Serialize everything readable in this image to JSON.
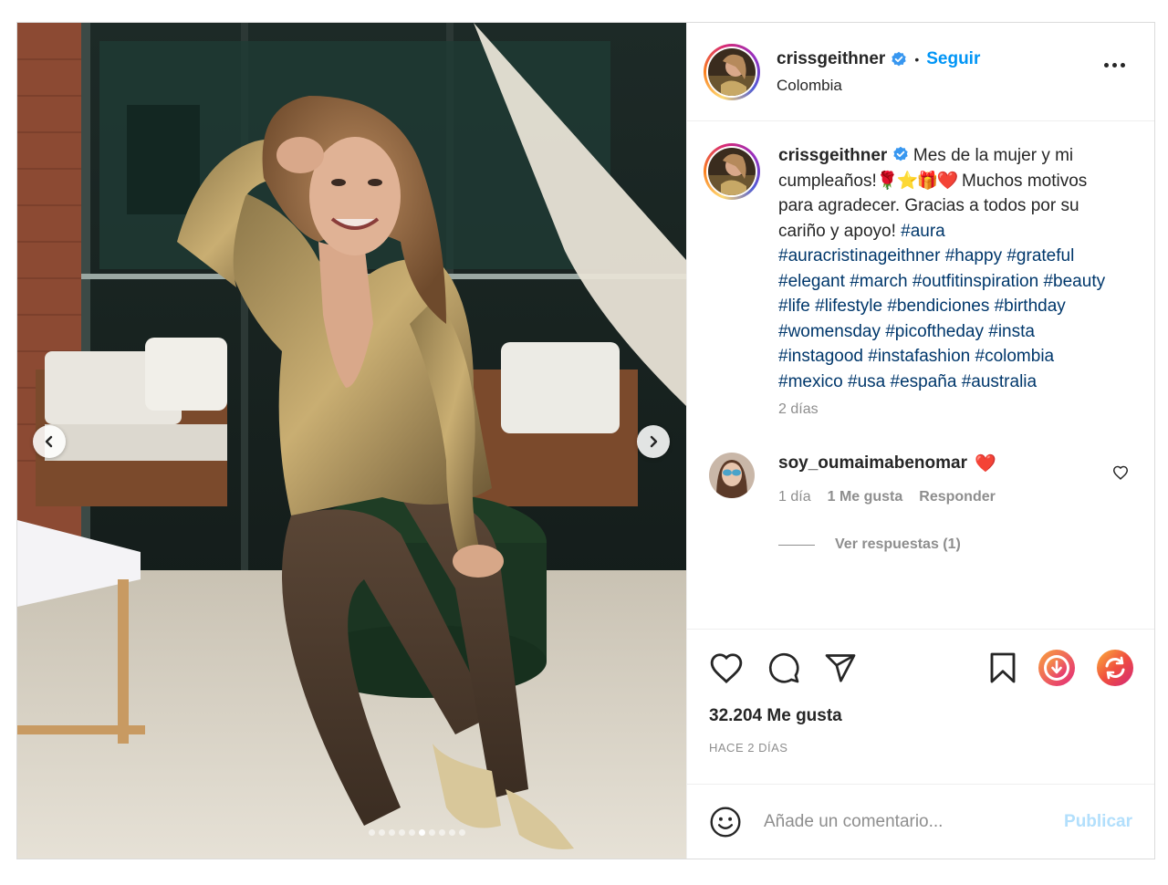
{
  "post": {
    "username": "crissgeithner",
    "verified": true,
    "follow_label": "Seguir",
    "separator": "•",
    "location": "Colombia"
  },
  "carousel": {
    "total": 10,
    "active_index": 5
  },
  "caption": {
    "username": "crissgeithner",
    "text_part1": "Mes de la mujer y mi cumpleaños!",
    "emojis": [
      "🌹",
      "⭐",
      "🎁",
      "❤️"
    ],
    "text_part2": "Muchos motivos para agradecer. Gracias a todos por su cariño y apoyo!",
    "hashtags": [
      "#aura",
      "#auracristinageithner",
      "#happy",
      "#grateful",
      "#elegant",
      "#march",
      "#outfitinspiration",
      "#beauty",
      "#life",
      "#lifestyle",
      "#bendiciones",
      "#birthday",
      "#womensday",
      "#picoftheday",
      "#insta",
      "#instagood",
      "#instafashion",
      "#colombia",
      "#mexico",
      "#usa",
      "#españa",
      "#australia"
    ],
    "time": "2 días"
  },
  "comment": {
    "username": "soy_oumaimabenomar",
    "text": "❤️",
    "time": "1 día",
    "likes": "1 Me gusta",
    "reply_label": "Responder",
    "view_replies": "Ver respuestas (1)"
  },
  "engagement": {
    "likes": "32.204 Me gusta",
    "posted": "HACE 2 DÍAS"
  },
  "composer": {
    "placeholder": "Añade un comentario...",
    "publish_label": "Publicar"
  },
  "icons": {
    "like": "heart-icon",
    "comment": "comment-icon",
    "share": "share-icon",
    "save": "bookmark-icon",
    "download": "download-icon",
    "repost": "repost-icon",
    "emoji": "smile-icon",
    "more": "more-options-icon"
  },
  "colors": {
    "link_blue": "#0095f6",
    "hashtag": "#00376b",
    "muted": "#8e8e8e",
    "publish_disabled": "#b2dffc",
    "like_red": "#ed4956"
  }
}
